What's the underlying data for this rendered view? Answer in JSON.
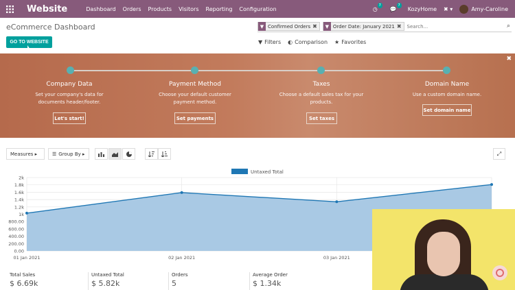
{
  "nav": {
    "brand": "Website",
    "menu": [
      "Dashboard",
      "Orders",
      "Products",
      "Visitors",
      "Reporting",
      "Configuration"
    ],
    "activity_count": "7",
    "messages_count": "7",
    "company": "KozyHome",
    "user": "Amy-Caroline"
  },
  "control": {
    "title": "eCommerce Dashboard",
    "go_button": "GO TO WEBSITE",
    "facets": [
      "Confirmed Orders",
      "Order Date: January 2021"
    ],
    "search_placeholder": "Search...",
    "filters": "Filters",
    "comparison": "Comparison",
    "favorites": "Favorites"
  },
  "banner": {
    "steps": [
      {
        "title": "Company Data",
        "desc": "Set your company's data for documents header/footer.",
        "button": "Let's start!"
      },
      {
        "title": "Payment Method",
        "desc": "Choose your default customer payment method.",
        "button": "Set payments"
      },
      {
        "title": "Taxes",
        "desc": "Choose a default sales tax for your products.",
        "button": "Set taxes"
      },
      {
        "title": "Domain Name",
        "desc": "Use a custom domain name.",
        "button": "Set domain name"
      }
    ]
  },
  "graph_controls": {
    "measures": "Measures ▸",
    "group_by": "Group By ▸"
  },
  "chart_data": {
    "type": "area",
    "legend": [
      "Untaxed Total"
    ],
    "x": [
      "01 Jan 2021",
      "02 Jan 2021",
      "03 Jan 2021",
      "04 Jan 2021"
    ],
    "series": [
      {
        "name": "Untaxed Total",
        "values": [
          1030,
          1590,
          1340,
          1810
        ]
      }
    ],
    "y_ticks": [
      "0.00",
      "200.00",
      "400.00",
      "600.00",
      "800.00",
      "1k",
      "1.2k",
      "1.4k",
      "1.6k",
      "1.8k",
      "2k"
    ],
    "x_ticks_visible": [
      "01 Jan 2021",
      "02 Jan 2021",
      "03 Jan 2021"
    ],
    "ylim": [
      0,
      2000
    ],
    "grid": true,
    "legend_position": "top-center",
    "color": "#1f77b4",
    "fill": "#a9c9e4"
  },
  "kpis": [
    {
      "label": "Total Sales",
      "value": "$ 6.69k"
    },
    {
      "label": "Untaxed Total",
      "value": "$ 5.82k"
    },
    {
      "label": "Orders",
      "value": "5"
    },
    {
      "label": "Average Order",
      "value": "$ 1.34k"
    }
  ],
  "colors": {
    "brand": "#875a7b",
    "accent": "#00a09d"
  }
}
